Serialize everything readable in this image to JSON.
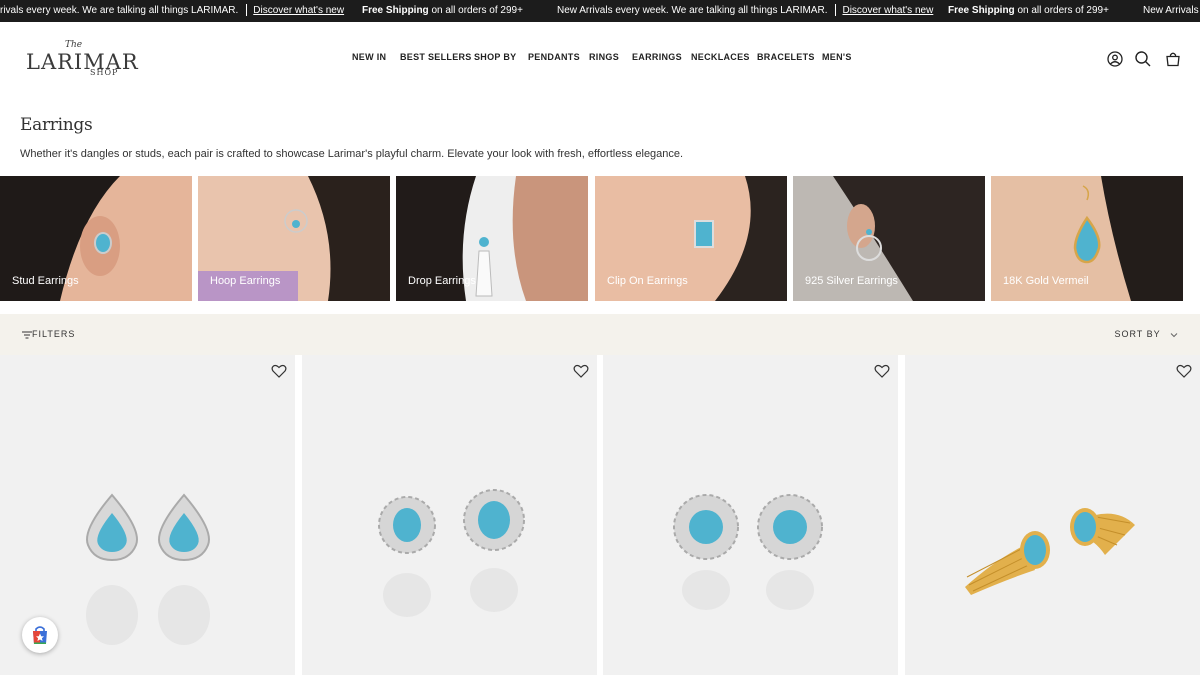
{
  "announcement": {
    "items": [
      {
        "text": "New Arrivals every week. We are talking all things LARIMAR.",
        "link": "Discover what's new"
      },
      {
        "bold": "Free Shipping",
        "text": "on all orders of 299+"
      }
    ],
    "segments": {
      "s1_text": "rivals every week. We are talking all things LARIMAR.",
      "s1_link": "Discover what's new",
      "s2_bold": "Free Shipping",
      "s2_text": "on all orders of 299+",
      "s3_text": "New Arrivals every week. We are talking all things LARIMAR.",
      "s3_link": "Discover what's new",
      "s4_bold": "Free Shipping",
      "s4_text": "on all orders of 299+",
      "s5_text": "New Arrivals e"
    }
  },
  "logo": {
    "the": "The",
    "word": "LARIMAR",
    "shop": "SHOP"
  },
  "nav": [
    "NEW IN",
    "BEST SELLERS",
    "SHOP BY",
    "PENDANTS",
    "RINGS",
    "EARRINGS",
    "NECKLACES",
    "BRACELETS",
    "MEN'S"
  ],
  "header_icons": [
    "account-icon",
    "search-icon",
    "cart-icon"
  ],
  "page": {
    "title": "Earrings",
    "description": "Whether it's dangles or studs, each pair is crafted to showcase Larimar's playful charm. Elevate your look with fresh, effortless elegance."
  },
  "categories": [
    "Stud Earrings",
    "Hoop Earrings",
    "Drop Earrings",
    "Clip On Earrings",
    "925 Silver Earrings",
    "18K Gold Vermeil"
  ],
  "toolbar": {
    "filters": "FILTERS",
    "sort": "SORT BY"
  },
  "products": [
    {
      "style": "silver teardrop halo studs"
    },
    {
      "style": "silver oval starburst studs"
    },
    {
      "style": "silver round starburst studs"
    },
    {
      "style": "gold shell fan studs"
    }
  ],
  "colors": {
    "topbar": "#1c1c1c",
    "filterbar": "#f4f2ec",
    "larimar": "#4fb3cf",
    "product_bg": "#f1f1f1"
  }
}
